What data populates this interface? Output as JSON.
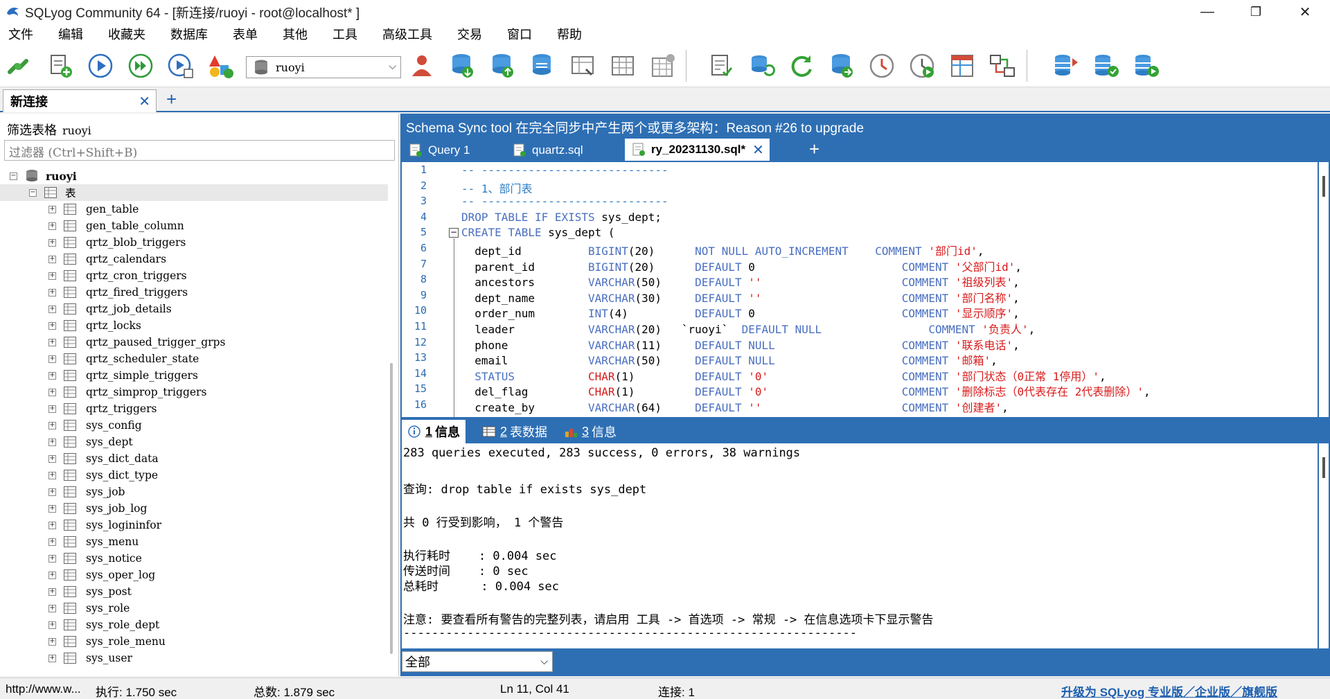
{
  "window": {
    "title": "SQLyog Community 64 - [新连接/ruoyi - root@localhost* ]",
    "minimize": "—",
    "restore": "❐",
    "close": "✕"
  },
  "menu": [
    "文件",
    "编辑",
    "收藏夹",
    "数据库",
    "表单",
    "其他",
    "工具",
    "高级工具",
    "交易",
    "窗口",
    "帮助"
  ],
  "toolbar": {
    "db_select_value": "ruoyi"
  },
  "connection_tab": {
    "label": "新连接",
    "close": "✕",
    "add": "+"
  },
  "left": {
    "filter_label": "筛选表格",
    "filter_db": "ruoyi",
    "filter_placeholder": "过滤器 (Ctrl+Shift+B)",
    "root_db": "ruoyi",
    "tables_node": "表",
    "tables": [
      "gen_table",
      "gen_table_column",
      "qrtz_blob_triggers",
      "qrtz_calendars",
      "qrtz_cron_triggers",
      "qrtz_fired_triggers",
      "qrtz_job_details",
      "qrtz_locks",
      "qrtz_paused_trigger_grps",
      "qrtz_scheduler_state",
      "qrtz_simple_triggers",
      "qrtz_simprop_triggers",
      "qrtz_triggers",
      "sys_config",
      "sys_dept",
      "sys_dict_data",
      "sys_dict_type",
      "sys_job",
      "sys_job_log",
      "sys_logininfor",
      "sys_menu",
      "sys_notice",
      "sys_oper_log",
      "sys_post",
      "sys_role",
      "sys_role_dept",
      "sys_role_menu",
      "sys_user"
    ]
  },
  "right": {
    "banner": "Schema Sync tool 在完全同步中产生两个或更多架构：Reason #26 to upgrade",
    "query_tabs": [
      {
        "label": "Query 1"
      },
      {
        "label": "quartz.sql"
      },
      {
        "label": "ry_20231130.sql*",
        "close": "✕"
      }
    ],
    "add_tab": "+",
    "editor_lines": [
      {
        "n": "1",
        "parts": [
          [
            "c",
            "-- ----------------------------"
          ]
        ]
      },
      {
        "n": "2",
        "parts": [
          [
            "c",
            "-- 1、部门表"
          ]
        ]
      },
      {
        "n": "3",
        "parts": [
          [
            "c",
            "-- ----------------------------"
          ]
        ]
      },
      {
        "n": "4",
        "parts": [
          [
            "k",
            "DROP TABLE IF EXISTS "
          ],
          [
            "",
            "sys_dept;"
          ]
        ]
      },
      {
        "n": "5",
        "parts": [
          [
            "k",
            "CREATE TABLE "
          ],
          [
            "",
            "sys_dept ("
          ]
        ]
      },
      {
        "n": "6",
        "parts": [
          [
            "",
            "  dept_id          "
          ],
          [
            "k",
            "BIGINT"
          ],
          [
            "",
            "(20)      "
          ],
          [
            "k",
            "NOT NULL AUTO_INCREMENT"
          ],
          [
            "",
            "    "
          ],
          [
            "cm",
            "COMMENT "
          ],
          [
            "s",
            "'部门id'"
          ],
          [
            "",
            ","
          ]
        ]
      },
      {
        "n": "7",
        "parts": [
          [
            "",
            "  parent_id        "
          ],
          [
            "k",
            "BIGINT"
          ],
          [
            "",
            "(20)      "
          ],
          [
            "k",
            "DEFAULT "
          ],
          [
            "",
            "0                      "
          ],
          [
            "cm",
            "COMMENT "
          ],
          [
            "s",
            "'父部门id'"
          ],
          [
            "",
            ","
          ]
        ]
      },
      {
        "n": "8",
        "parts": [
          [
            "",
            "  ancestors        "
          ],
          [
            "k",
            "VARCHAR"
          ],
          [
            "",
            "(50)     "
          ],
          [
            "k",
            "DEFAULT "
          ],
          [
            "s",
            "''"
          ],
          [
            "",
            "                     "
          ],
          [
            "cm",
            "COMMENT "
          ],
          [
            "s",
            "'祖级列表'"
          ],
          [
            "",
            ","
          ]
        ]
      },
      {
        "n": "9",
        "parts": [
          [
            "",
            "  dept_name        "
          ],
          [
            "k",
            "VARCHAR"
          ],
          [
            "",
            "(30)     "
          ],
          [
            "k",
            "DEFAULT "
          ],
          [
            "s",
            "''"
          ],
          [
            "",
            "                     "
          ],
          [
            "cm",
            "COMMENT "
          ],
          [
            "s",
            "'部门名称'"
          ],
          [
            "",
            ","
          ]
        ]
      },
      {
        "n": "10",
        "parts": [
          [
            "",
            "  order_num        "
          ],
          [
            "k",
            "INT"
          ],
          [
            "",
            "(4)          "
          ],
          [
            "k",
            "DEFAULT "
          ],
          [
            "",
            "0                      "
          ],
          [
            "cm",
            "COMMENT "
          ],
          [
            "s",
            "'显示顺序'"
          ],
          [
            "",
            ","
          ]
        ]
      },
      {
        "n": "11",
        "parts": [
          [
            "",
            "  leader           "
          ],
          [
            "k",
            "VARCHAR"
          ],
          [
            "",
            "(20)   `ruoyi`  "
          ],
          [
            "k",
            "DEFAULT NULL"
          ],
          [
            "",
            "                "
          ],
          [
            "cm",
            "COMMENT "
          ],
          [
            "s",
            "'负责人'"
          ],
          [
            "",
            ","
          ]
        ]
      },
      {
        "n": "12",
        "parts": [
          [
            "",
            "  phone            "
          ],
          [
            "k",
            "VARCHAR"
          ],
          [
            "",
            "(11)     "
          ],
          [
            "k",
            "DEFAULT NULL"
          ],
          [
            "",
            "                   "
          ],
          [
            "cm",
            "COMMENT "
          ],
          [
            "s",
            "'联系电话'"
          ],
          [
            "",
            ","
          ]
        ]
      },
      {
        "n": "13",
        "parts": [
          [
            "",
            "  email            "
          ],
          [
            "k",
            "VARCHAR"
          ],
          [
            "",
            "(50)     "
          ],
          [
            "k",
            "DEFAULT NULL"
          ],
          [
            "",
            "                   "
          ],
          [
            "cm",
            "COMMENT "
          ],
          [
            "s",
            "'邮箱'"
          ],
          [
            "",
            ","
          ]
        ]
      },
      {
        "n": "14",
        "parts": [
          [
            "",
            "  "
          ],
          [
            "k",
            "STATUS"
          ],
          [
            "",
            "           "
          ],
          [
            "s",
            "CHAR"
          ],
          [
            "",
            "(1)         "
          ],
          [
            "k",
            "DEFAULT "
          ],
          [
            "s",
            "'0'"
          ],
          [
            "",
            "                    "
          ],
          [
            "cm",
            "COMMENT "
          ],
          [
            "s",
            "'部门状态（0正常 1停用）'"
          ],
          [
            "",
            ","
          ]
        ]
      },
      {
        "n": "15",
        "parts": [
          [
            "",
            "  del_flag         "
          ],
          [
            "s",
            "CHAR"
          ],
          [
            "",
            "(1)         "
          ],
          [
            "k",
            "DEFAULT "
          ],
          [
            "s",
            "'0'"
          ],
          [
            "",
            "                    "
          ],
          [
            "cm",
            "COMMENT "
          ],
          [
            "s",
            "'删除标志（0代表存在 2代表删除）'"
          ],
          [
            "",
            ","
          ]
        ]
      },
      {
        "n": "16",
        "parts": [
          [
            "",
            "  create_by        "
          ],
          [
            "k",
            "VARCHAR"
          ],
          [
            "",
            "(64)     "
          ],
          [
            "k",
            "DEFAULT "
          ],
          [
            "s",
            "''"
          ],
          [
            "",
            "                     "
          ],
          [
            "cm",
            "COMMENT "
          ],
          [
            "s",
            "'创建者'"
          ],
          [
            "",
            ","
          ]
        ]
      }
    ],
    "result_tabs": [
      {
        "num": "1",
        "label": "信息"
      },
      {
        "num": "2",
        "label": "表数据"
      },
      {
        "num": "3",
        "label": "信息"
      }
    ],
    "result_lines": [
      "283 queries executed, 283 success, 0 errors, 38 warnings",
      "",
      "查询: drop table if exists sys_dept",
      "",
      "共 0 行受到影响， 1 个警告",
      "",
      "执行耗时    : 0.004 sec",
      "传送时间    : 0 sec",
      "总耗时      : 0.004 sec",
      "",
      "注意: 要查看所有警告的完整列表，请启用 工具 -> 首选项 -> 常规 -> 在信息选项卡下显示警告",
      "----------------------------------------------------------------"
    ],
    "filter_select": "全部"
  },
  "status": {
    "url": "http://www.w...",
    "exec": "执行: 1.750 sec",
    "total": "总数: 1.879 sec",
    "position": "Ln 11, Col 41",
    "connections": "连接: 1",
    "upgrade": "升级为 SQLyog 专业版／企业版／旗舰版"
  },
  "colors": {
    "accent": "#2e6fb4",
    "string": "#d81b1b",
    "keyword": "#4a6fc0"
  }
}
